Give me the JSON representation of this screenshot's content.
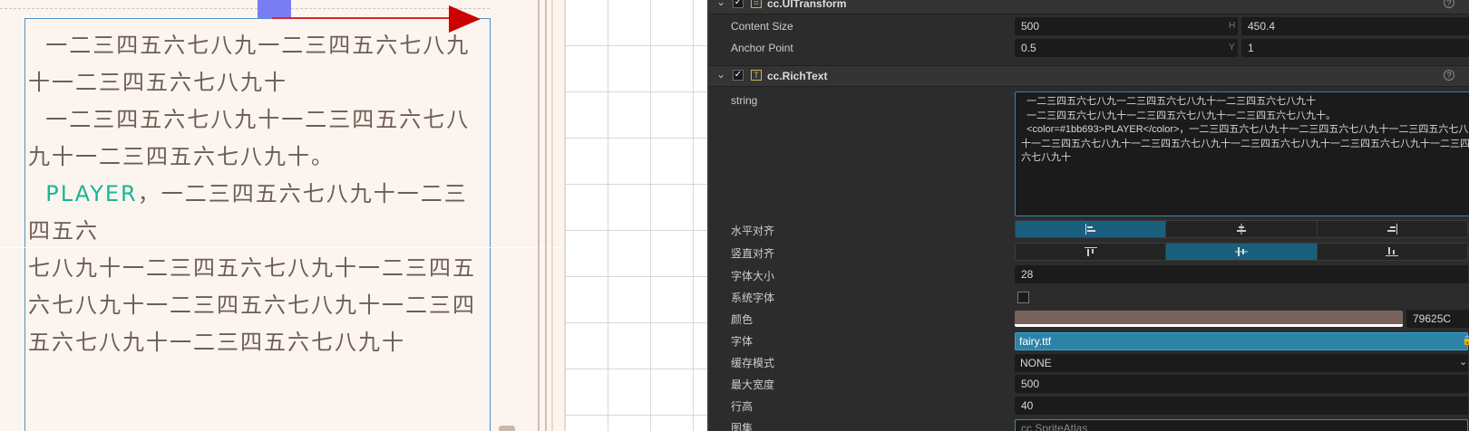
{
  "scene": {
    "richtext_lines": [
      "  一二三四五六七八九一二三四五六七八九十一二三四五六七八九十",
      "  一二三四五六七八九十一二三四五六七八九十一二三四五六七八九十。"
    ],
    "player_text": "PLAYER",
    "after_player": "，一二三四五六七八九十一二三四五六",
    "last_line": "七八九十一二三四五六七八九十一二三四五六七八九十一二三四五六七八九十一二三四五六七八九十一二三四五六七八九十"
  },
  "inspector": {
    "uitransform": {
      "title": "cc.UITransform",
      "content_size_label": "Content Size",
      "width": "500",
      "height": "450.4",
      "anchor_label": "Anchor Point",
      "anchor_x": "0.5",
      "anchor_y": "1",
      "axis_h": "H",
      "axis_y": "Y"
    },
    "richtext": {
      "title": "cc.RichText",
      "string_label": "string",
      "string_value": "  一二三四五六七八九一二三四五六七八九十一二三四五六七八九十\n  一二三四五六七八九十一二三四五六七八九十一二三四五六七八九十。\n  <color=#1bb693>PLAYER</color>，一二三四五六七八九十一二三四五六七八九十一二三四五六七八九十一二三四五六七八九十一二三四五六七八九十一二三四五六七八九十一二三四五六七八九十一二三四五六七八九十",
      "halign_label": "水平对齐",
      "valign_label": "竖直对齐",
      "font_size_label": "字体大小",
      "font_size": "28",
      "system_font_label": "系统字体",
      "color_label": "颜色",
      "color_hex": "79625C",
      "color_value": "#79625c",
      "font_label": "字体",
      "font_asset": "fairy.ttf",
      "cache_label": "缓存模式",
      "cache_mode": "NONE",
      "max_width_label": "最大宽度",
      "max_width": "500",
      "line_height_label": "行高",
      "line_height": "40",
      "atlas_label": "图集",
      "atlas_value": "cc.SpriteAtlas"
    }
  },
  "colors": {
    "accent": "#2b83a8",
    "player_green": "#1bb693",
    "text_brown": "#6f5d55",
    "gizmo_red": "#cc0000",
    "gizmo_blue": "#7a7df2"
  }
}
